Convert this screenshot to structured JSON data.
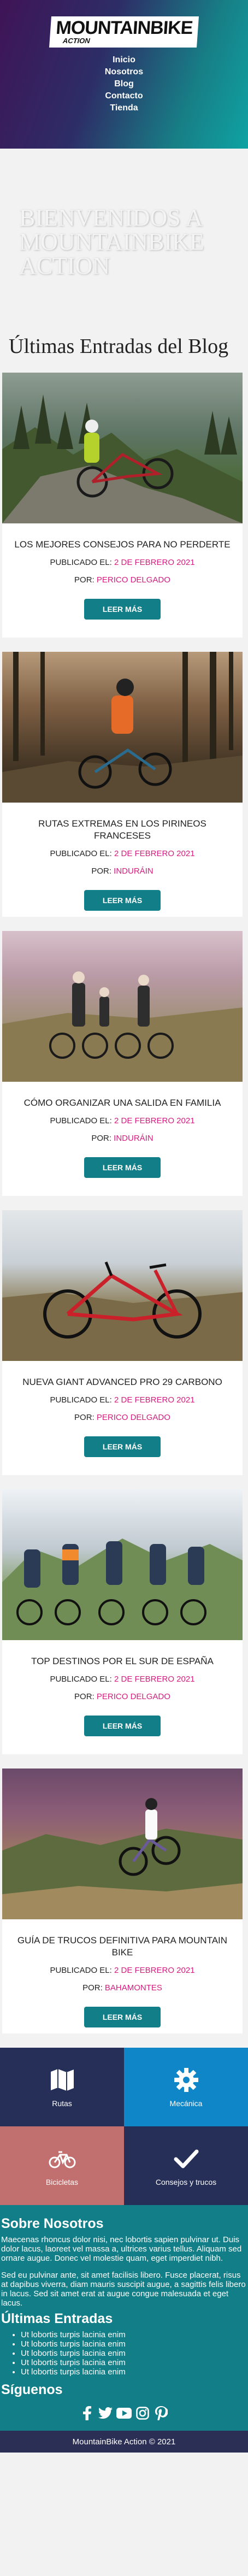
{
  "header": {
    "logo_main": "MOUNTAINBIKE",
    "logo_sub": "ACTION",
    "nav": [
      "Inicio",
      "Nosotros",
      "Blog",
      "Contacto",
      "Tienda"
    ]
  },
  "hero": {
    "title": "Bienvenidos a Mountainbike Action"
  },
  "blog": {
    "title": "Últimas Entradas del Blog",
    "published_label": "PUBLICADO EL:",
    "by_label": "POR:",
    "button_label": "LEER MÁS",
    "posts": [
      {
        "title": "LOS MEJORES CONSEJOS PARA NO PERDERTE",
        "date": "2 DE FEBRERO 2021",
        "author": "PERICO DELGADO"
      },
      {
        "title": "RUTAS EXTREMAS EN LOS PIRINEOS FRANCESES",
        "date": "2 DE FEBRERO 2021",
        "author": "INDURÁIN"
      },
      {
        "title": "CÓMO ORGANIZAR UNA SALIDA EN FAMILIA",
        "date": "2 DE FEBRERO 2021",
        "author": "INDURÁIN"
      },
      {
        "title": "NUEVA GIANT ADVANCED PRO 29 CARBONO",
        "date": "2 DE FEBRERO 2021",
        "author": "PERICO DELGADO"
      },
      {
        "title": "TOP DESTINOS POR EL SUR DE ESPAÑA",
        "date": "2 DE FEBRERO 2021",
        "author": "PERICO DELGADO"
      },
      {
        "title": "GUÍA DE TRUCOS DEFINITIVA PARA MOUNTAIN BIKE",
        "date": "2 DE FEBRERO 2021",
        "author": "BAHAMONTES"
      }
    ]
  },
  "categories": [
    {
      "label": "Rutas",
      "icon": "map-icon",
      "color": "#262f57"
    },
    {
      "label": "Mecánica",
      "icon": "gear-icon",
      "color": "#0f86c7"
    },
    {
      "label": "Bicicletas",
      "icon": "bicycle-icon",
      "color": "#c2706f"
    },
    {
      "label": "Consejos y trucos",
      "icon": "check-icon",
      "color": "#262f57"
    }
  ],
  "footer": {
    "about_title": "Sobre Nosotros",
    "about_p1": "Maecenas rhoncus dolor nisi, nec lobortis sapien pulvinar ut. Duis dolor lacus, laoreet vel massa a, ultrices varius tellus. Aliquam sed ornare augue. Donec vel molestie quam, eget imperdiet nibh.",
    "about_p2": "Sed eu pulvinar ante, sit amet facilisis libero. Fusce placerat, risus at dapibus viverra, diam mauris suscipit augue, a sagittis felis libero in lacus. Sed sit amet erat at augue congue malesuada et eget lacus.",
    "entries_title": "Últimas Entradas",
    "entries": [
      "Ut lobortis turpis lacinia enim",
      "Ut lobortis turpis lacinia enim",
      "Ut lobortis turpis lacinia enim",
      "Ut lobortis turpis lacinia enim",
      "Ut lobortis turpis lacinia enim"
    ],
    "follow_title": "Síguenos",
    "social": [
      "facebook-icon",
      "twitter-icon",
      "youtube-icon",
      "instagram-icon",
      "pinterest-icon"
    ],
    "copyright": "MountainBike Action © 2021"
  },
  "colors": {
    "accent": "#127e87",
    "highlight": "#d51b7e",
    "dark": "#2b2f55"
  }
}
